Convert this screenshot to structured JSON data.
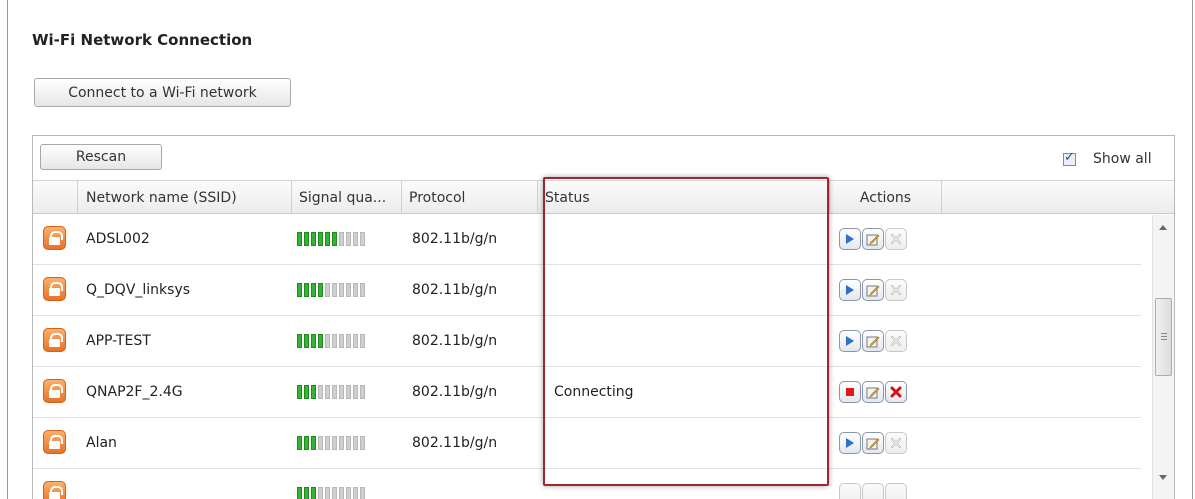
{
  "title": "Wi-Fi Network Connection",
  "connect_button": "Connect to a Wi-Fi network",
  "rescan_button": "Rescan",
  "show_all": {
    "label": "Show all",
    "checked": true
  },
  "columns": {
    "ssid": "Network name (SSID)",
    "signal": "Signal qua...",
    "protocol": "Protocol",
    "status": "Status",
    "actions": "Actions"
  },
  "networks": [
    {
      "ssid": "ADSL002",
      "signal_bars": 6,
      "signal_total": 10,
      "protocol": "802.11b/g/n",
      "status": "",
      "action_primary": "play-icon",
      "delete_enabled": false
    },
    {
      "ssid": "Q_DQV_linksys",
      "signal_bars": 4,
      "signal_total": 10,
      "protocol": "802.11b/g/n",
      "status": "",
      "action_primary": "play-icon",
      "delete_enabled": false
    },
    {
      "ssid": "APP-TEST",
      "signal_bars": 4,
      "signal_total": 10,
      "protocol": "802.11b/g/n",
      "status": "",
      "action_primary": "play-icon",
      "delete_enabled": false
    },
    {
      "ssid": "QNAP2F_2.4G",
      "signal_bars": 3,
      "signal_total": 10,
      "protocol": "802.11b/g/n",
      "status": "Connecting",
      "action_primary": "stop-icon",
      "delete_enabled": true
    },
    {
      "ssid": "Alan",
      "signal_bars": 3,
      "signal_total": 10,
      "protocol": "802.11b/g/n",
      "status": "",
      "action_primary": "play-icon",
      "delete_enabled": false
    }
  ],
  "colors": {
    "highlight": "#a3242b",
    "signal_on": "#36b236",
    "lock": "#e8722a"
  }
}
